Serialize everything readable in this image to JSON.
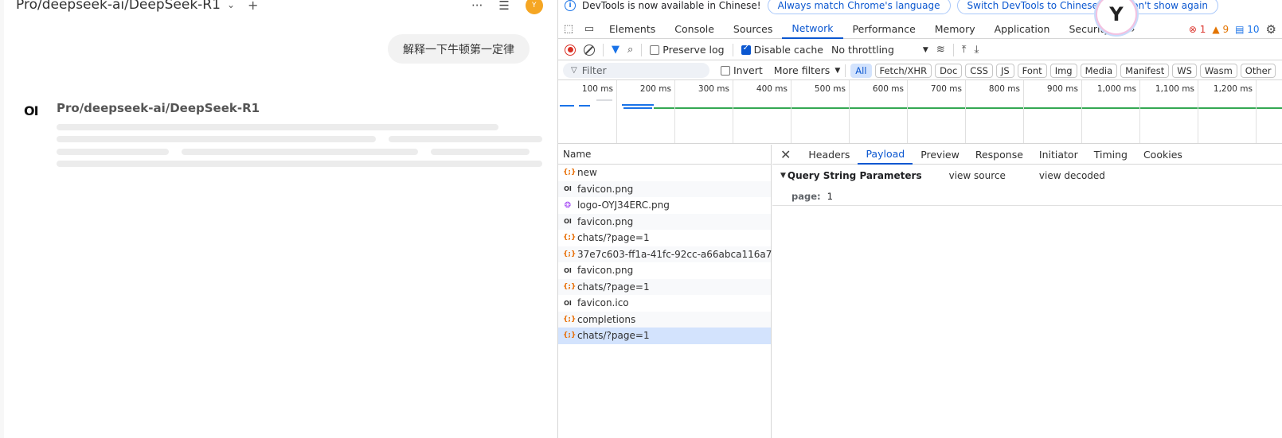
{
  "chat": {
    "model_title": "Pro/deepseek-ai/DeepSeek-R1",
    "avatar_letter": "Y",
    "user_message": "解释一下牛顿第一定律",
    "bot_logo": "OI",
    "bot_name": "Pro/deepseek-ai/DeepSeek-R1"
  },
  "devtools": {
    "infobar": {
      "message": "DevTools is now available in Chinese!",
      "btn_match": "Always match Chrome's language",
      "btn_switch": "Switch DevTools to Chinese",
      "btn_dont": "Don't show again"
    },
    "tabs": [
      "Elements",
      "Console",
      "Sources",
      "Network",
      "Performance",
      "Memory",
      "Application",
      "Security"
    ],
    "active_tab": "Network",
    "more_tabs": "»",
    "errors": "1",
    "warnings": "9",
    "messages": "10",
    "toolbar": {
      "preserve_log": "Preserve log",
      "disable_cache": "Disable cache",
      "throttling": "No throttling"
    },
    "filter": {
      "placeholder": "Filter",
      "invert": "Invert",
      "more_filters": "More filters",
      "chips": [
        "All",
        "Fetch/XHR",
        "Doc",
        "CSS",
        "JS",
        "Font",
        "Img",
        "Media",
        "Manifest",
        "WS",
        "Wasm",
        "Other"
      ]
    },
    "timeline": {
      "labels": [
        "100 ms",
        "200 ms",
        "300 ms",
        "400 ms",
        "500 ms",
        "600 ms",
        "700 ms",
        "800 ms",
        "900 ms",
        "1,000 ms",
        "1,100 ms",
        "1,200 ms"
      ]
    },
    "requests": {
      "header": "Name",
      "rows": [
        {
          "name": "new",
          "type": "xhr"
        },
        {
          "name": "favicon.png",
          "type": "img"
        },
        {
          "name": "logo-OYJ34ERC.png",
          "type": "logo"
        },
        {
          "name": "favicon.png",
          "type": "img"
        },
        {
          "name": "chats/?page=1",
          "type": "xhr"
        },
        {
          "name": "37e7c603-ff1a-41fc-92cc-a66abca116a7",
          "type": "xhr"
        },
        {
          "name": "favicon.png",
          "type": "img"
        },
        {
          "name": "chats/?page=1",
          "type": "xhr"
        },
        {
          "name": "favicon.ico",
          "type": "img"
        },
        {
          "name": "completions",
          "type": "xhr"
        },
        {
          "name": "chats/?page=1",
          "type": "xhr"
        }
      ],
      "selected_index": 10
    },
    "detail": {
      "tabs": [
        "Headers",
        "Payload",
        "Preview",
        "Response",
        "Initiator",
        "Timing",
        "Cookies"
      ],
      "active_tab": "Payload",
      "section_title": "Query String Parameters",
      "view_source": "view source",
      "view_decoded": "view decoded",
      "param_key": "page:",
      "param_value": "1"
    }
  }
}
